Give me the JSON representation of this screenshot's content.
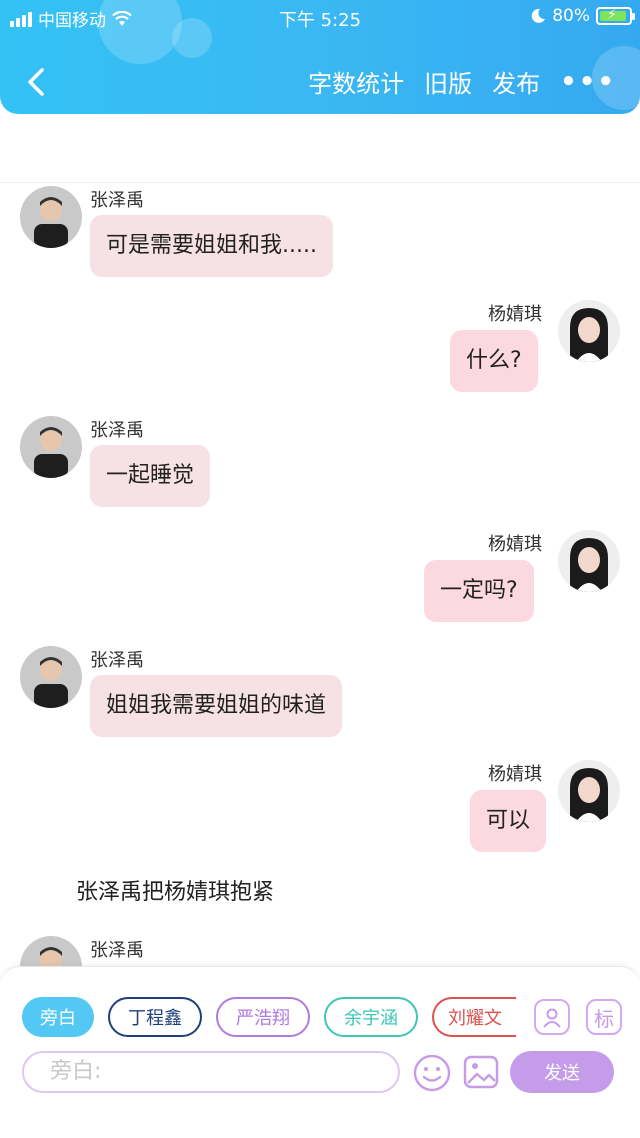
{
  "status_bar": {
    "carrier": "中国移动",
    "time": "下午 5:25",
    "battery": "80%"
  },
  "nav": {
    "word_count": "字数统计",
    "old_version": "旧版",
    "publish": "发布",
    "more": "•••"
  },
  "messages": [
    {
      "side": "left",
      "name": "张泽禹",
      "text": "可是需要姐姐和我....."
    },
    {
      "side": "right",
      "name": "杨婧琪",
      "text": "什么?"
    },
    {
      "side": "left",
      "name": "张泽禹",
      "text": "一起睡觉"
    },
    {
      "side": "right",
      "name": "杨婧琪",
      "text": "一定吗?"
    },
    {
      "side": "left",
      "name": "张泽禹",
      "text": "姐姐我需要姐姐的味道"
    },
    {
      "side": "right",
      "name": "杨婧琪",
      "text": "可以"
    },
    {
      "side": "left",
      "name": "张泽禹",
      "text": ""
    }
  ],
  "narration": "张泽禹把杨婧琪抱紧",
  "composer": {
    "roles": [
      {
        "label": "旁白",
        "color": "#54c8f4"
      },
      {
        "label": "丁程鑫",
        "color": "#1f3f7a"
      },
      {
        "label": "严浩翔",
        "color": "#b07be0"
      },
      {
        "label": "余宇涵",
        "color": "#3cc6b5"
      },
      {
        "label": "刘耀文",
        "color": "#d9534f"
      }
    ],
    "mark_button": "标",
    "input_placeholder": "旁白:",
    "send_label": "发送"
  }
}
